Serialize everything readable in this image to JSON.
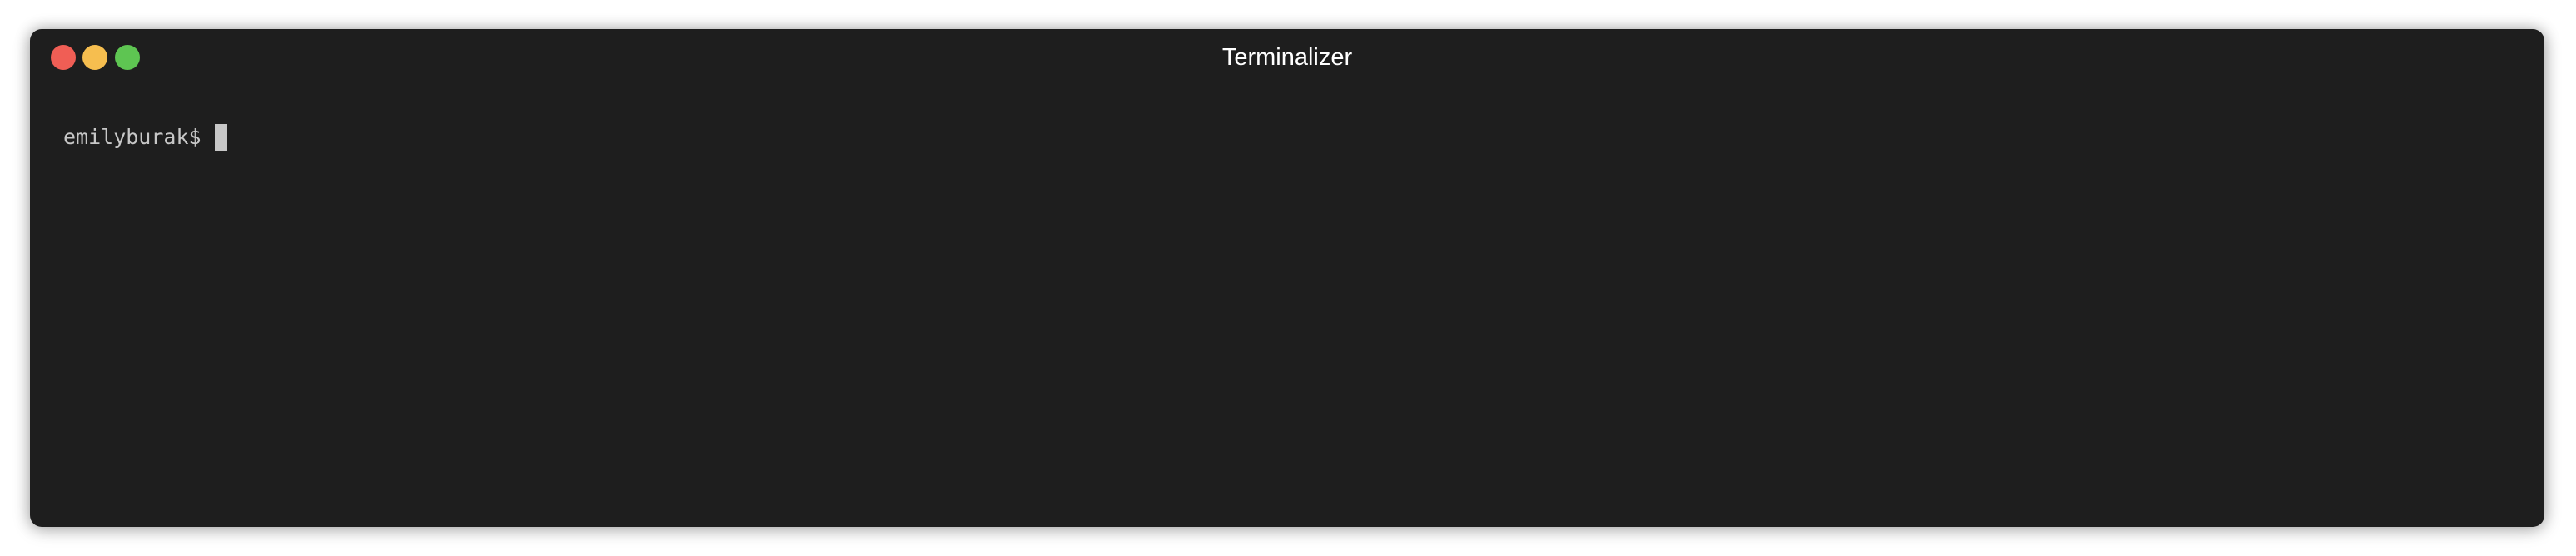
{
  "window": {
    "title": "Terminalizer",
    "background_color": "#1e1e1e",
    "traffic_lights": {
      "close_color": "#f05e55",
      "minimize_color": "#f6be4f",
      "zoom_color": "#5ec552"
    }
  },
  "terminal": {
    "prompt": "emilyburak$",
    "text_color": "#c7c7c7",
    "cursor_color": "#c7c7c7"
  }
}
